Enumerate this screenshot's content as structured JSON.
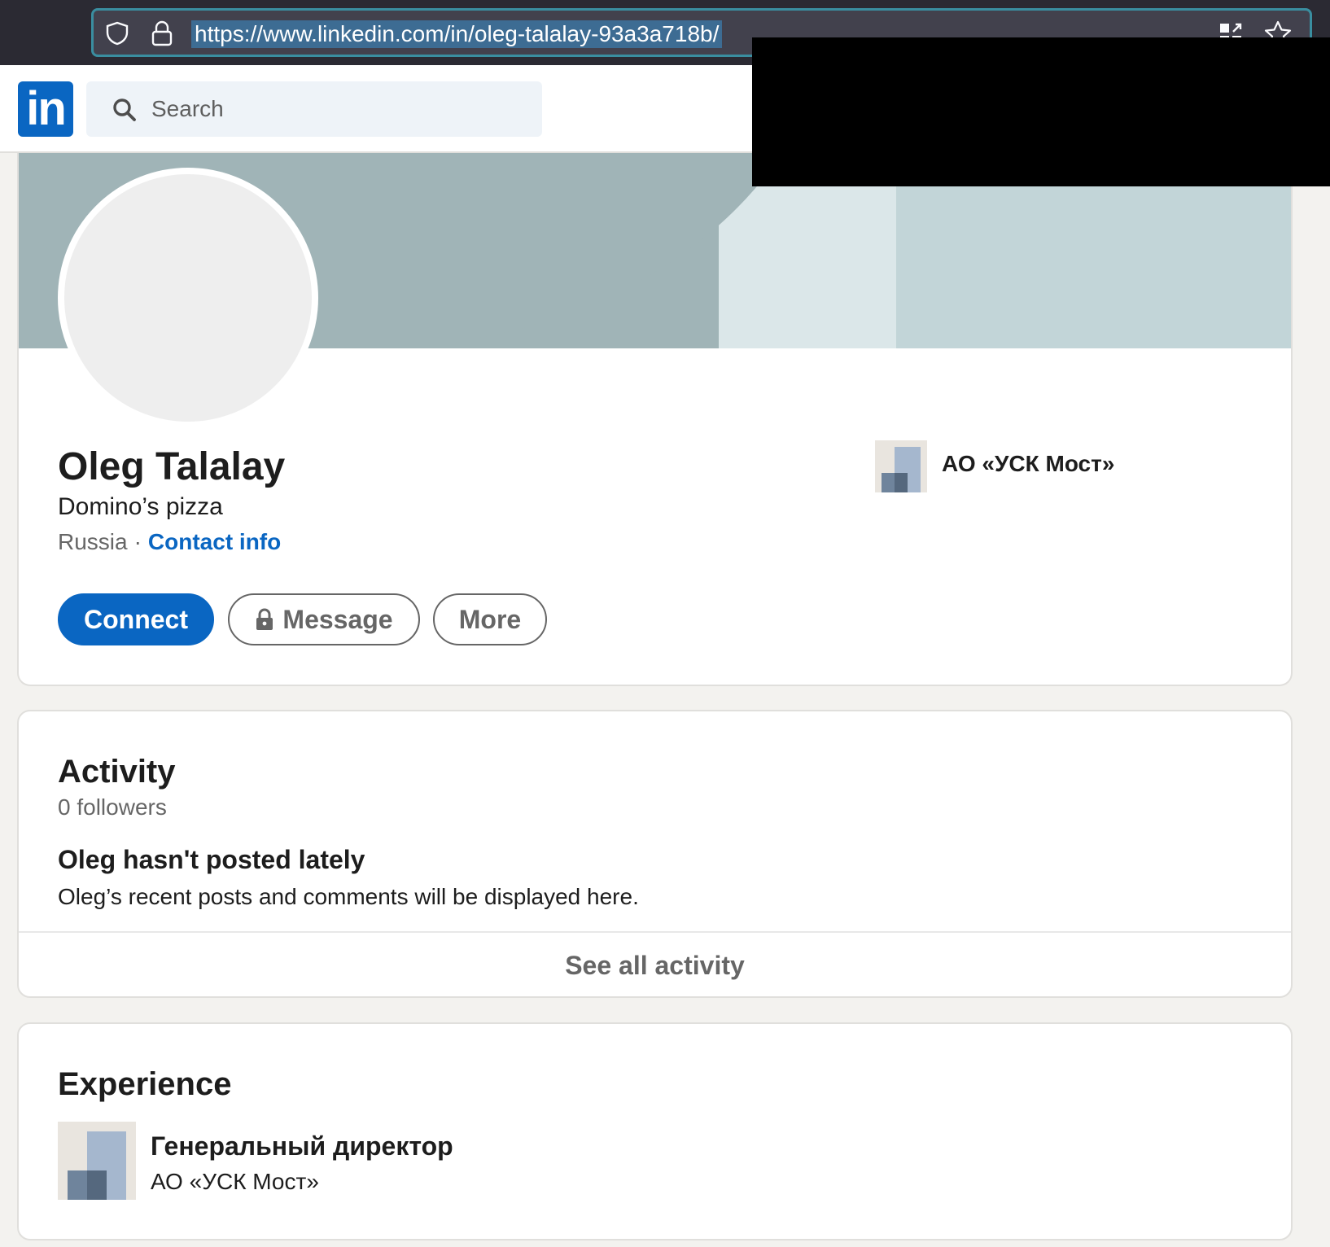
{
  "browser": {
    "url": "https://www.linkedin.com/in/oleg-talalay-93a3a718b/"
  },
  "header": {
    "logo_text": "in",
    "search_placeholder": "Search"
  },
  "profile": {
    "name": "Oleg Talalay",
    "headline": "Domino’s pizza",
    "location": "Russia",
    "separator": "·",
    "contact_label": "Contact info",
    "company": "АО «УСК Мост»",
    "buttons": {
      "connect": "Connect",
      "message": "Message",
      "more": "More"
    }
  },
  "activity": {
    "title": "Activity",
    "followers": "0 followers",
    "empty_title": "Oleg hasn't posted lately",
    "empty_desc": "Oleg’s recent posts and comments will be displayed here.",
    "see_all": "See all activity"
  },
  "experience": {
    "title": "Experience",
    "items": [
      {
        "role": "Генеральный директор",
        "company": "АО «УСК Мост»"
      }
    ]
  },
  "colors": {
    "brand_blue": "#0a66c2",
    "page_bg": "#f3f2ef",
    "banner": "#a0b4b7"
  }
}
